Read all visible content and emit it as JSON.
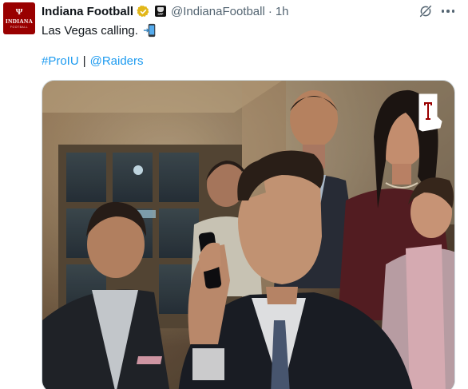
{
  "author": {
    "display_name": "Indiana Football",
    "handle": "@IndianaFootball",
    "timestamp": "1h",
    "dot": "·",
    "avatar": {
      "trident": "Ψ",
      "name": "INDIANA",
      "sub": "FOOTBALL"
    },
    "affiliate_badge_text": "CFP"
  },
  "tweet": {
    "text": "Las Vegas calling.",
    "hashtag": "#ProIU",
    "separator": "|",
    "mention": "@Raiders"
  },
  "icons": {
    "verified": "verified-badge-icon",
    "affiliate": "affiliate-badge-icon",
    "grok": "grok-icon",
    "more": "more-options-icon",
    "phone": "mobile-phone-arrow-emoji",
    "media_badge": "indiana-state-iu-logo-icon"
  },
  "colors": {
    "link": "#1d9bf0",
    "text": "#0f1419",
    "muted": "#536471",
    "brand": "#990000",
    "verified_gold": "#e2b719"
  }
}
